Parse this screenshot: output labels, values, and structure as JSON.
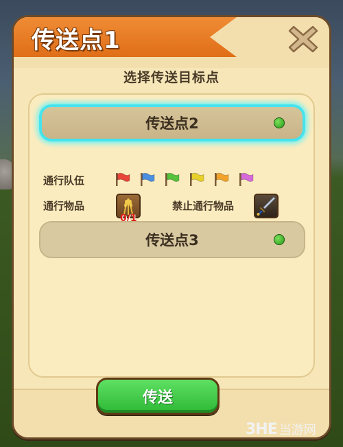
{
  "dialog": {
    "title": "传送点1",
    "subtitle": "选择传送目标点",
    "close_icon": "close-x-icon"
  },
  "destinations": [
    {
      "label": "传送点2",
      "selected": true,
      "status": "available",
      "status_color": "#39b52a"
    },
    {
      "label": "传送点3",
      "selected": false,
      "status": "available",
      "status_color": "#39b52a"
    }
  ],
  "details": {
    "team_label": "通行队伍",
    "team_flags": [
      {
        "name": "red-flag-icon",
        "color": "#e8453a"
      },
      {
        "name": "blue-flag-icon",
        "color": "#4a8fe0"
      },
      {
        "name": "green-flag-icon",
        "color": "#54c23a"
      },
      {
        "name": "yellow-flag-icon",
        "color": "#e8d02a"
      },
      {
        "name": "orange-flag-icon",
        "color": "#f2a22a"
      },
      {
        "name": "purple-flag-icon",
        "color": "#d66ad8"
      }
    ],
    "pass_item_label": "通行物品",
    "pass_item": {
      "icon": "wheat-icon",
      "count": "0/1"
    },
    "banned_item_label": "禁止通行物品",
    "banned_item": {
      "icon": "sword-icon"
    }
  },
  "actions": {
    "teleport_label": "传送"
  },
  "watermark": {
    "logo": "3HE",
    "text": "当游网"
  },
  "colors": {
    "title_ribbon": "#e87a22",
    "selected_glow": "#46e3ee",
    "button_green": "#3cc843",
    "panel_bg": "#f6e6b8"
  }
}
